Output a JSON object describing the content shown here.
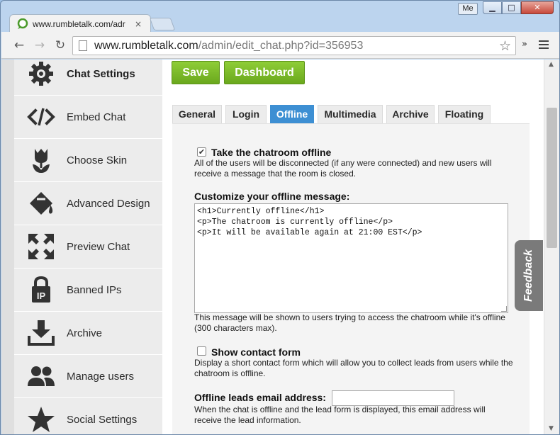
{
  "browser": {
    "tab_title": "www.rumbletalk.com/adr",
    "tab_close": "×",
    "user_badge": "Me",
    "window_buttons": {
      "minimize": "▁",
      "maximize": "□",
      "close": "✕"
    },
    "url_host": "www.rumbletalk.com",
    "url_path": "/admin/edit_chat.php?id=356953",
    "star": "☆",
    "ext_overflow": "»",
    "nav": {
      "back": "←",
      "forward": "→",
      "reload": "↻"
    }
  },
  "sidebar": {
    "items": [
      {
        "label": "Chat Settings",
        "icon": "gear-icon"
      },
      {
        "label": "Embed Chat",
        "icon": "code-icon"
      },
      {
        "label": "Choose Skin",
        "icon": "tulip-icon"
      },
      {
        "label": "Advanced Design",
        "icon": "paint-bucket-icon"
      },
      {
        "label": "Preview Chat",
        "icon": "expand-arrows-icon"
      },
      {
        "label": "Banned IPs",
        "icon": "ip-lock-icon"
      },
      {
        "label": "Archive",
        "icon": "download-tray-icon"
      },
      {
        "label": "Manage users",
        "icon": "users-icon"
      },
      {
        "label": "Social Settings",
        "icon": "star-icon"
      }
    ]
  },
  "actions": {
    "save": "Save",
    "dashboard": "Dashboard"
  },
  "tabs": [
    "General",
    "Login",
    "Offline",
    "Multimedia",
    "Archive",
    "Floating"
  ],
  "active_tab": "Offline",
  "offline": {
    "take_offline_label": "Take the chatroom offline",
    "take_offline_checked": true,
    "take_offline_desc": "All of the users will be disconnected (if any were connected) and new users will receive a message that the room is closed.",
    "customize_label": "Customize your offline message:",
    "message_value": "<h1>Currently offline</h1>\n<p>The chatroom is currently offline</p>\n<p>It will be available again at 21:00 EST</p>",
    "message_help": "This message will be shown to users trying to access the chatroom while it's offline (300 characters max).",
    "contact_label": "Show contact form",
    "contact_checked": false,
    "contact_desc": "Display a short contact form which will allow you to collect leads from users while the chatroom is offline.",
    "email_label": "Offline leads email address:",
    "email_value": "",
    "email_desc": "When the chat is offline and the lead form is displayed, this email address will receive the lead information."
  },
  "feedback_label": "Feedback",
  "scroll": {
    "up": "▲",
    "down": "▼"
  },
  "colors": {
    "accent_green": "#7ab928",
    "tab_active": "#3d8fd3",
    "sidebar_bg": "#ececec"
  }
}
